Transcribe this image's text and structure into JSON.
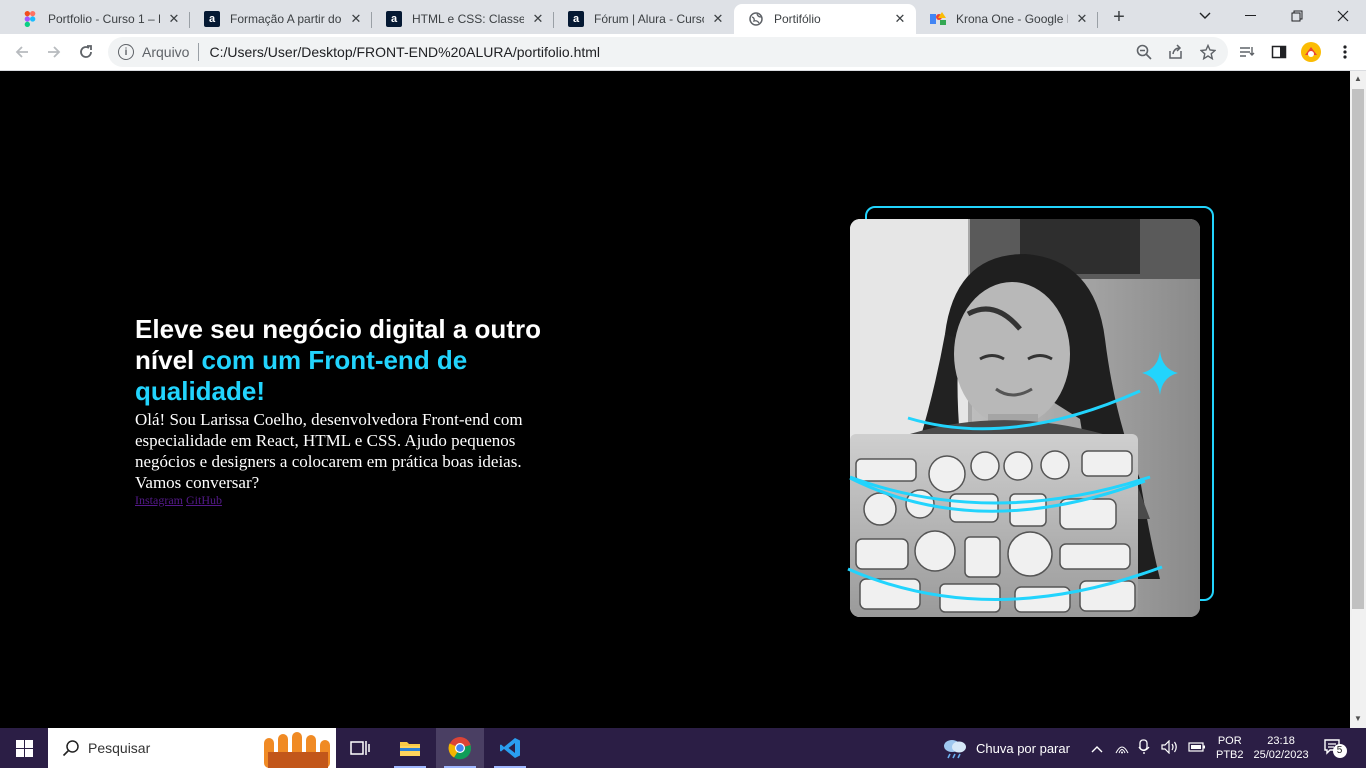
{
  "browser": {
    "tabs": [
      {
        "title": "Portfolio - Curso 1 – F",
        "favicon": "figma-icon",
        "active": false
      },
      {
        "title": "Formação A partir do",
        "favicon": "alura-icon",
        "active": false
      },
      {
        "title": "HTML e CSS: Classes,",
        "favicon": "alura-icon",
        "active": false
      },
      {
        "title": "Fórum | Alura - Curso",
        "favicon": "alura-icon",
        "active": false
      },
      {
        "title": "Portifólio",
        "favicon": "globe-icon",
        "active": true
      },
      {
        "title": "Krona One - Google F",
        "favicon": "google-fonts-icon",
        "active": false
      }
    ],
    "omnibox": {
      "security_chip": "Arquivo",
      "url": "C:/Users/User/Desktop/FRONT-END%20ALURA/portifolio.html"
    }
  },
  "page": {
    "title_part1": "Eleve seu negócio digital a outro nível ",
    "title_accent": "com um Front-end de qualidade!",
    "intro": "Olá! Sou Larissa Coelho, desenvolvedora Front-end com especialidade em React, HTML e CSS. Ajudo pequenos negócios e designers a colocarem em prática boas ideias. Vamos conversar?",
    "links": {
      "instagram": "Instagram",
      "github": "GitHub"
    },
    "colors": {
      "accent": "#22d4fd",
      "background": "#000000",
      "visited_link": "#551a8b"
    }
  },
  "taskbar": {
    "search_placeholder": "Pesquisar",
    "weather": "Chuva por parar",
    "lang_top": "POR",
    "lang_bottom": "PTB2",
    "time": "23:18",
    "date": "25/02/2023",
    "notifications": "5"
  }
}
